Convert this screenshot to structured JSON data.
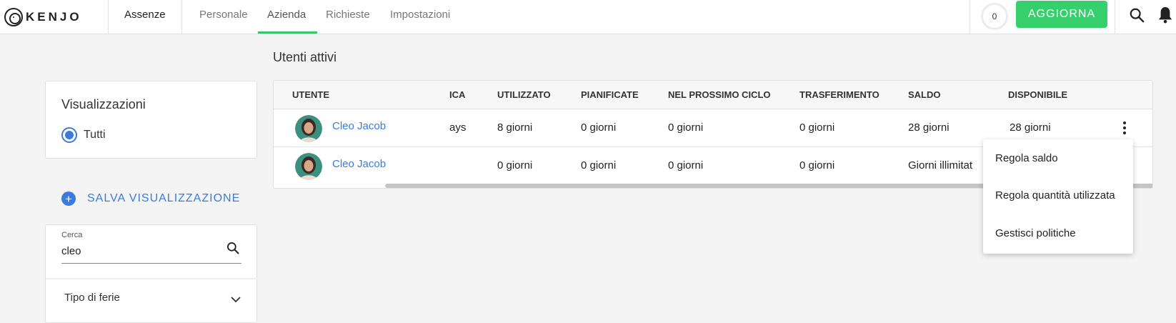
{
  "header": {
    "logo_text": "KENJO",
    "section": "Assenze",
    "tabs": [
      "Personale",
      "Azienda",
      "Richieste",
      "Impostazioni"
    ],
    "active_tab": "Azienda",
    "counter": "0",
    "update_label": "AGGIORNA"
  },
  "main": {
    "title": "Utenti attivi"
  },
  "sidebar": {
    "views_title": "Visualizzazioni",
    "views_option": "Tutti",
    "save_view_label": "SALVA VISUALIZZAZIONE",
    "search_label": "Cerca",
    "search_value": "cleo",
    "leave_type_label": "Tipo di ferie"
  },
  "table": {
    "columns": [
      "UTENTE",
      "ICA",
      "UTILIZZATO",
      "PIANIFICATE",
      "NEL PROSSIMO CICLO",
      "TRASFERIMENTO",
      "SALDO",
      "DISPONIBILE"
    ],
    "rows": [
      {
        "user": "Cleo Jacob",
        "policy": "ays",
        "used": "8 giorni",
        "planned": "0 giorni",
        "next_cycle": "0 giorni",
        "transfer": "0 giorni",
        "balance": "28 giorni",
        "available": "28 giorni"
      },
      {
        "user": "Cleo Jacob",
        "policy": "",
        "used": "0 giorni",
        "planned": "0 giorni",
        "next_cycle": "0 giorni",
        "transfer": "0 giorni",
        "balance": "Giorni illimitat",
        "available": ""
      }
    ]
  },
  "context_menu": {
    "items": [
      "Regola saldo",
      "Regola quantità utilizzata",
      "Gestisci politiche"
    ]
  },
  "colors": {
    "accent_green": "#35d06c",
    "link_blue": "#3a7be0"
  }
}
